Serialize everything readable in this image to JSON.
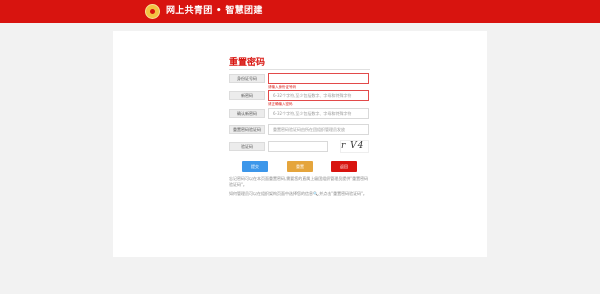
{
  "header": {
    "title": "网上共青团 • 智慧团建",
    "brand_color": "#d8140f"
  },
  "form": {
    "title": "重置密码",
    "id_label": "身份证号码",
    "id_value": "",
    "id_hint": "请输入身份证号码",
    "new_password_label": "新密码",
    "new_password_placeholder": "6-32个字符,至少包括数字、字母和特殊字符",
    "new_password_hint": "请正确输入密码",
    "confirm_password_label": "确认新密码",
    "confirm_password_placeholder": "6-32个字符,至少包括数字、字母和特殊字符",
    "reset_code_label": "重置密码验证码",
    "reset_code_placeholder": "重置密码验证码由所在团组织管理员发放",
    "captcha_label": "验证码",
    "captcha_value": "",
    "captcha_image_text": "r V4 3"
  },
  "buttons": {
    "submit": "提交",
    "reset": "重置",
    "back": "返回"
  },
  "notes": {
    "line1": "忘记密码可以在本页面重置密码,需要您的直属上级团组织管理员提供\"重置密码验证码\"。",
    "line2": "如何管理员可以在组织架构页面中选择您的信息🔍,并点击\"重置密码验证码\"。"
  }
}
